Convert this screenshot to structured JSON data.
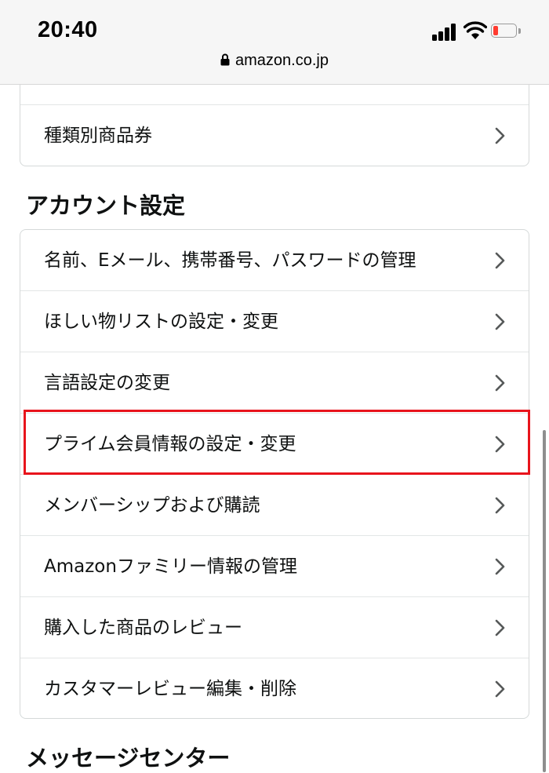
{
  "status_bar": {
    "time": "20:40",
    "url": "amazon.co.jp",
    "battery_color": "#ff3b30"
  },
  "top_card": {
    "rows": [
      {
        "label": ""
      },
      {
        "label": "種類別商品券"
      }
    ]
  },
  "account_settings": {
    "heading": "アカウント設定",
    "rows": [
      {
        "label": "名前、Eメール、携帯番号、パスワードの管理"
      },
      {
        "label": "ほしい物リストの設定・変更"
      },
      {
        "label": "言語設定の変更"
      },
      {
        "label": "プライム会員情報の設定・変更"
      },
      {
        "label": "メンバーシップおよび購読"
      },
      {
        "label": "Amazonファミリー情報の管理"
      },
      {
        "label": "購入した商品のレビュー"
      },
      {
        "label": "カスタマーレビュー編集・削除"
      }
    ]
  },
  "message_center": {
    "heading": "メッセージセンター"
  },
  "icons": {
    "chevron": "chevron-right-icon",
    "lock": "lock-icon",
    "signal": "cellular-signal-icon",
    "wifi": "wifi-icon",
    "battery": "battery-icon"
  },
  "highlight_color": "#e8141c"
}
